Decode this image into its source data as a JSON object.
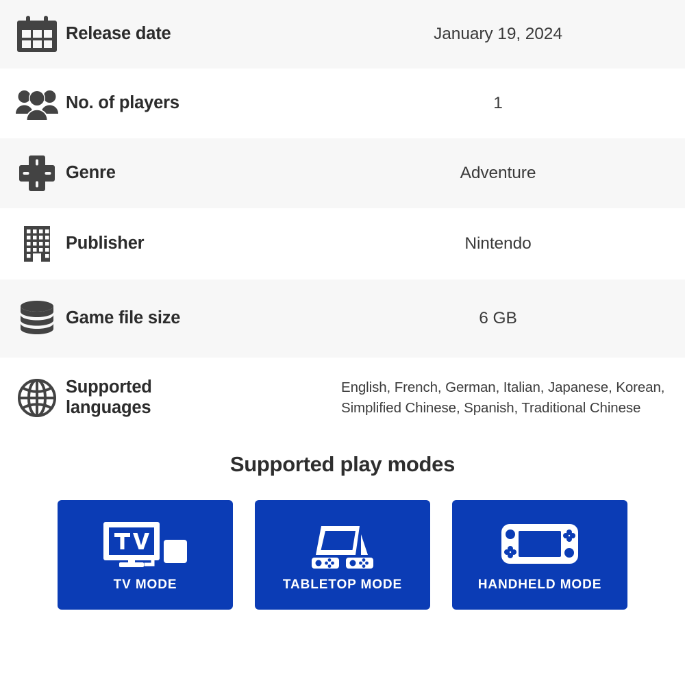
{
  "spec_rows": [
    {
      "icon": "calendar-icon",
      "label": "Release date",
      "value": "January 19, 2024",
      "striped": true
    },
    {
      "icon": "players-icon",
      "label": "No. of players",
      "value": "1",
      "striped": false
    },
    {
      "icon": "dpad-icon",
      "label": "Genre",
      "value": "Adventure",
      "striped": true
    },
    {
      "icon": "building-icon",
      "label": "Publisher",
      "value": "Nintendo",
      "striped": false
    },
    {
      "icon": "database-icon",
      "label": "Game file size",
      "value": "6 GB",
      "striped": true
    },
    {
      "icon": "globe-icon",
      "label": "Supported languages",
      "value": "English, French, German, Italian, Japanese, Korean, Simplified Chinese, Spanish, Traditional Chinese",
      "striped": false
    }
  ],
  "labels": {
    "release_date": "Release date",
    "no_of_players": "No. of players",
    "genre": "Genre",
    "publisher": "Publisher",
    "game_file_size": "Game file size",
    "supported_languages_line1": "Supported",
    "supported_languages_line2": "languages"
  },
  "values": {
    "release_date": "January 19, 2024",
    "no_of_players": "1",
    "genre": "Adventure",
    "publisher": "Nintendo",
    "game_file_size": "6 GB",
    "languages_line1": "English, French, German, Italian, Japanese, Korean,",
    "languages_line2": "Simplified Chinese, Spanish, Traditional Chinese",
    "languages_list": [
      "English",
      "French",
      "German",
      "Italian",
      "Japanese",
      "Korean",
      "Simplified Chinese",
      "Spanish",
      "Traditional Chinese"
    ]
  },
  "play_modes": {
    "title": "Supported play modes",
    "cards": [
      {
        "icon": "tv-mode-icon",
        "label": "TV MODE",
        "screen_text": "TV"
      },
      {
        "icon": "tabletop-mode-icon",
        "label": "TABLETOP MODE"
      },
      {
        "icon": "handheld-mode-icon",
        "label": "HANDHELD MODE"
      }
    ]
  },
  "colors": {
    "card_blue": "#0b3cb5",
    "row_stripe": "#f7f7f7",
    "row_plain": "#ffffff",
    "icon_gray": "#434343",
    "label_text": "#2c2c2c",
    "value_text": "#3a3a3a",
    "card_text": "#ffffff"
  }
}
